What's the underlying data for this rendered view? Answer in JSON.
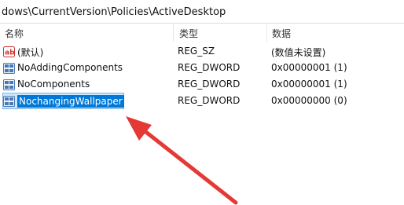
{
  "address": {
    "path": "dows\\CurrentVersion\\Policies\\ActiveDesktop"
  },
  "columns": {
    "name": "名称",
    "type": "类型",
    "data": "数据"
  },
  "rows": [
    {
      "name": "(默认)",
      "type": "REG_SZ",
      "data": "(数值未设置)",
      "icon": "string-value-icon"
    },
    {
      "name": "NoAddingComponents",
      "type": "REG_DWORD",
      "data": "0x00000001 (1)",
      "icon": "dword-value-icon"
    },
    {
      "name": "NoComponents",
      "type": "REG_DWORD",
      "data": "0x00000001 (1)",
      "icon": "dword-value-icon"
    },
    {
      "name": "NochangingWallpaper",
      "type": "REG_DWORD",
      "data": "0x00000000 (0)",
      "icon": "dword-value-icon",
      "selected": true
    }
  ],
  "colors": {
    "selection": "#0078d7",
    "selection_box": "#cce8ff",
    "arrow": "#e53935"
  }
}
